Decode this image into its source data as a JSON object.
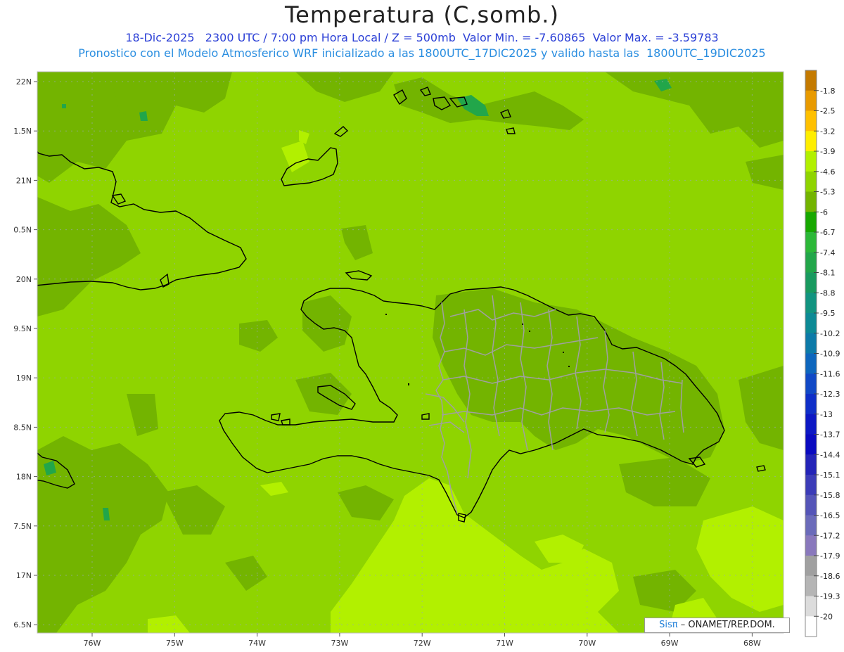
{
  "header": {
    "title": "Temperatura (C,somb.)",
    "subtitle_1": "18-Dic-2025   2300 UTC / 7:00 pm Hora Local / Z = 500mb  Valor Min. = -7.60865  Valor Max. = -3.59783",
    "subtitle_2": "Pronostico con el Modelo Atmosferico WRF inicializado a las 1800UTC_17DIC2025 y valido hasta las  1800UTC_19DIC2025"
  },
  "map": {
    "lat_labels": [
      "22N",
      "1.5N",
      "21N",
      "0.5N",
      "20N",
      "9.5N",
      "19N",
      "8.5N",
      "18N",
      "7.5N",
      "17N",
      "6.5N"
    ],
    "lon_labels": [
      "76W",
      "75W",
      "74W",
      "73W",
      "72W",
      "71W",
      "70W",
      "69W",
      "68W"
    ],
    "colors": {
      "base_field": "#8fd400",
      "darker_field": "#73b400",
      "lighter_field": "#b2f000",
      "coast": "#000000",
      "borders": "#a0a0a0"
    }
  },
  "colorbar": {
    "levels": [
      "-1.8",
      "-2.5",
      "-3.2",
      "-3.9",
      "-4.6",
      "-5.3",
      "-6",
      "-6.7",
      "-7.4",
      "-8.1",
      "-8.8",
      "-9.5",
      "-10.2",
      "-10.9",
      "-11.6",
      "-12.3",
      "-13",
      "-13.7",
      "-14.4",
      "-15.1",
      "-15.8",
      "-16.5",
      "-17.2",
      "-17.9",
      "-18.6",
      "-19.3",
      "-20"
    ],
    "colors": [
      "#c47a00",
      "#e89a00",
      "#ffc000",
      "#ffee00",
      "#b2f000",
      "#8fd400",
      "#73b400",
      "#17a800",
      "#2cb838",
      "#22a64a",
      "#199a5f",
      "#129480",
      "#0d8a95",
      "#0d7aa8",
      "#0e66bd",
      "#1149c6",
      "#0f2fc8",
      "#0d18c4",
      "#0a0ac0",
      "#2424b8",
      "#3c3cb8",
      "#5555b8",
      "#6b6bba",
      "#8978bc",
      "#a0a0a0",
      "#b5b5b5",
      "#dcdcdc",
      "#ffffff"
    ]
  },
  "credit": {
    "brand": "Sisπ",
    "text": "– ONAMET/REP.DOM."
  }
}
